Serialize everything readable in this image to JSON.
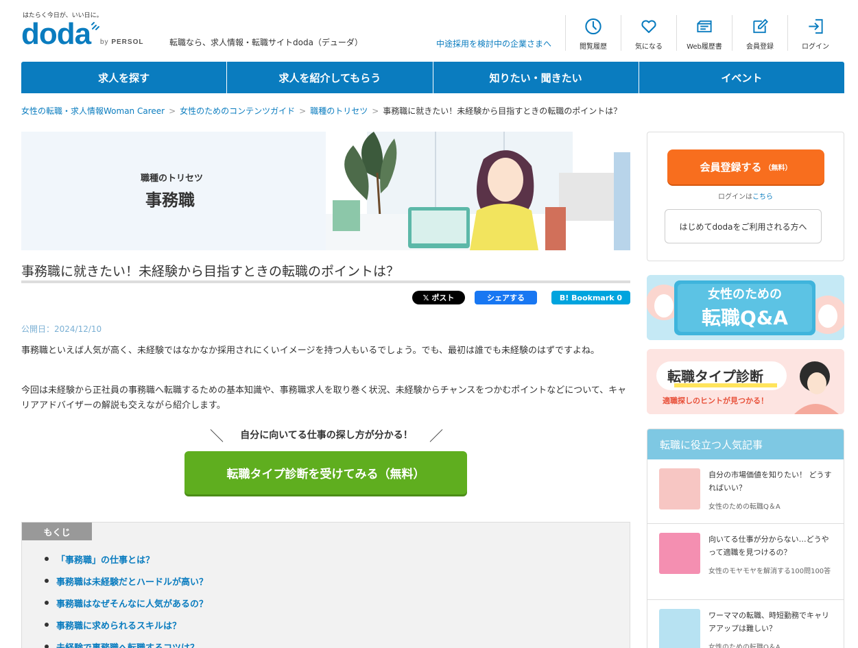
{
  "header": {
    "tagline": "はたらく今日が、いい日に。",
    "logo": "doda",
    "byline_by": "by",
    "byline_brand": "PERSOL",
    "site_desc": "転職なら、求人情報・転職サイトdoda（デューダ）",
    "biz_link": "中途採用を検討中の企業さまへ",
    "nav": [
      {
        "label": "閲覧履歴",
        "icon": "clock-icon"
      },
      {
        "label": "気になる",
        "icon": "heart-icon"
      },
      {
        "label": "Web履歴書",
        "icon": "resume-icon"
      },
      {
        "label": "会員登録",
        "icon": "edit-icon"
      },
      {
        "label": "ログイン",
        "icon": "login-icon"
      }
    ]
  },
  "mainnav": [
    "求人を探す",
    "求人を紹介してもらう",
    "知りたい・聞きたい",
    "イベント"
  ],
  "breadcrumb": {
    "items": [
      "女性の転職・求人情報Woman Career",
      "女性のためのコンテンツガイド",
      "職種のトリセツ"
    ],
    "separator": ">",
    "current": "事務職に就きたい！未経験から目指すときの転職のポイントは？"
  },
  "hero": {
    "category": "職種のトリセツ",
    "title": "事務職"
  },
  "article": {
    "title": "事務職に就きたい！未経験から目指すときの転職のポイントは？",
    "share_x": "𝕏 ポスト",
    "share_fb": "シェアする",
    "share_hb": "B! Bookmark  0",
    "pubdate": "公開日：2024/12/10",
    "para1": "事務職といえば人気が高く、未経験ではなかなか採用されにくいイメージを持つ人もいるでしょう。でも、最初は誰でも未経験のはずですよね。",
    "para2": "今回は未経験から正社員の事務職へ転職するための基本知識や、事務職求人を取り巻く状況、未経験からチャンスをつかむポイントなどについて、キャリアアドバイザーの解説も交えながら紹介します。",
    "cta_lead": "自分に向いてる仕事の探し方が分かる！",
    "cta_button": "転職タイプ診断を受けてみる（無料）"
  },
  "toc": {
    "label": "もくじ",
    "items": [
      "「事務職」の仕事とは？",
      "事務職は未経験だとハードルが高い？",
      "事務職はなぜそんなに人気があるの？",
      "事務職に求められるスキルは？",
      "未経験で事務職へ転職するコツは？"
    ]
  },
  "sidebar": {
    "register_label": "会員登録する",
    "register_note": "（無料）",
    "login_text": "ログインは",
    "login_link": "こちら",
    "first_time": "はじめてdodaをご利用される方へ",
    "banner1_line1": "女性のための",
    "banner1_line2": "転職Q&A",
    "banner2_title": "転職タイプ診断",
    "banner2_sub": "適職探しのヒントが見つかる！",
    "popular_head": "転職に役立つ人気記事",
    "popular": [
      {
        "title": "自分の市場価値を知りたい！ どうすればいい？",
        "category": "女性のための転職Q＆A"
      },
      {
        "title": "向いてる仕事が分からない…どうやって適職を見つけるの？",
        "category": "女性のモヤモヤを解消する100問100答"
      },
      {
        "title": "ワーママの転職、時短勤務でキャリアアップは難しい？",
        "category": "女性のための転職Q＆A"
      }
    ]
  },
  "colors": {
    "brand": "#0a7cbf",
    "cta_green": "#5fae1f",
    "register_orange": "#f86e1e"
  }
}
